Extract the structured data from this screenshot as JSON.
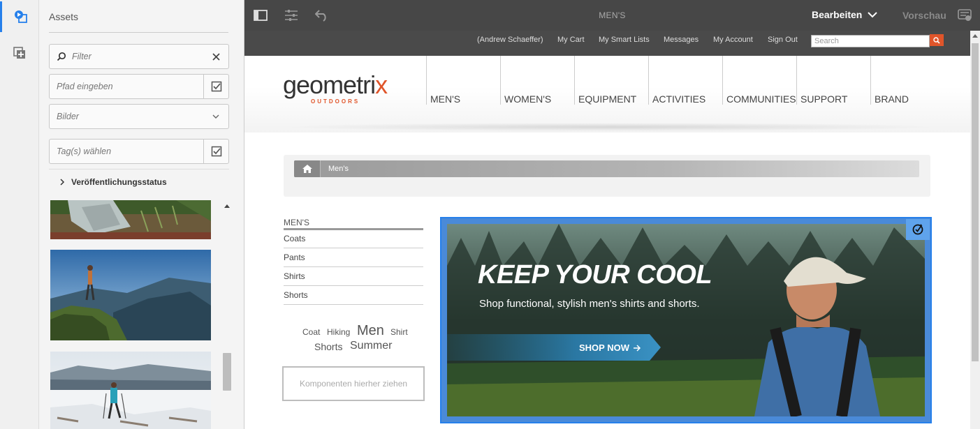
{
  "panel": {
    "title": "Assets",
    "filter_placeholder": "Filter",
    "path_placeholder": "Pfad eingeben",
    "type_value": "Bilder",
    "tags_placeholder": "Tag(s) wählen",
    "publication_status_label": "Veröffentlichungsstatus"
  },
  "toolbar": {
    "page_title": "MEN'S",
    "edit_label": "Bearbeiten",
    "preview_label": "Vorschau"
  },
  "site": {
    "top_links": [
      "(Andrew Schaeffer)",
      "My Cart",
      "My Smart Lists",
      "Messages",
      "My Account",
      "Sign Out"
    ],
    "search_placeholder": "Search",
    "logo_word": "geometri",
    "logo_x": "x",
    "logo_sub": "OUTDOORS",
    "nav": [
      "MEN'S",
      "WOMEN'S",
      "EQUIPMENT",
      "ACTIVITIES",
      "COMMUNITIES",
      "SUPPORT",
      "BRAND"
    ],
    "breadcrumb": "Men's",
    "category": {
      "heading": "MEN'S",
      "items": [
        "Coats",
        "Pants",
        "Shirts",
        "Shorts"
      ]
    },
    "tags": [
      "Coat",
      "Hiking",
      "Men",
      "Shirt",
      "Shorts",
      "Summer"
    ],
    "dropzone": "Komponenten hierher ziehen",
    "hero": {
      "headline": "KEEP YOUR COOL",
      "subline": "Shop functional, stylish men's shirts and shorts.",
      "cta": "SHOP NOW"
    }
  },
  "colors": {
    "accent": "#2680eb",
    "brand_orange": "#e0552a",
    "toolbar": "#474747"
  }
}
